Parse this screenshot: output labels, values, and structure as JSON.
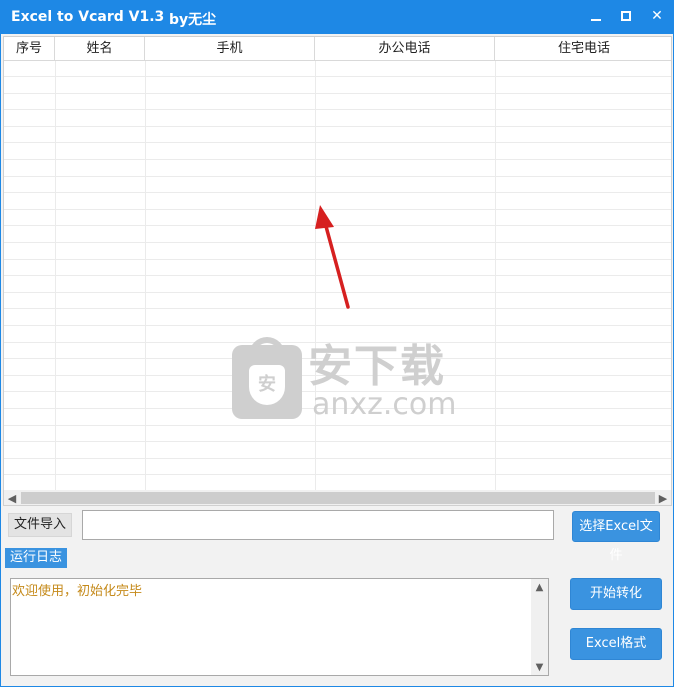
{
  "window": {
    "title": "Excel to Vcard V1.3",
    "author": "by无尘"
  },
  "grid": {
    "columns": [
      "序号",
      "姓名",
      "手机",
      "办公电话",
      "住宅电话"
    ],
    "row_count": 26
  },
  "file_import": {
    "label": "文件导入",
    "value": "",
    "select_button": "选择Excel文件"
  },
  "log": {
    "label": "运行日志",
    "text": "欢迎使用，初始化完毕"
  },
  "actions": {
    "start_button": "开始转化",
    "format_button": "Excel格式"
  },
  "watermark": {
    "cn": "安下载",
    "en": "anxz.com",
    "badge": "安"
  },
  "colors": {
    "accent": "#1e88e5",
    "button": "#3a93e0",
    "log_text": "#c58a1a",
    "arrow": "#d62020"
  }
}
